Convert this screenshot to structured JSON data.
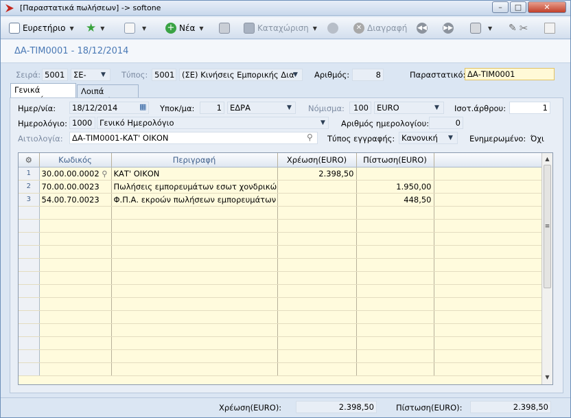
{
  "window": {
    "title": "[Παραστατικά πωλήσεων] -> softone"
  },
  "toolbar": {
    "index_label": "Ευρετήριο",
    "new_label": "Νέα",
    "save_label": "Καταχώριση",
    "delete_label": "Διαγραφή"
  },
  "document": {
    "title": "ΔΑ-ΤΙΜ0001 - 18/12/2014"
  },
  "header": {
    "series_label": "Σειρά:",
    "series_code": "5001",
    "series_name": "ΣΕ-",
    "type_label": "Τύπος:",
    "type_code": "5001",
    "type_name": "(ΣΕ) Κινήσεις Εμπορικής Δια",
    "number_label": "Αριθμός:",
    "number_value": "8",
    "doc_label": "Παραστατικό:",
    "doc_value": "ΔΑ-ΤΙΜ0001"
  },
  "tabs": [
    {
      "label": "Γενικά στοιχεία"
    },
    {
      "label": "Λοιπά στοιχεία"
    }
  ],
  "general": {
    "date_label": "Ημερ/νία:",
    "date_value": "18/12/2014",
    "branch_label": "Υποκ/μα:",
    "branch_code": "1",
    "branch_name": "ΕΔΡΑ",
    "currency_label": "Νόμισμα:",
    "currency_code": "100",
    "currency_name": "EURO",
    "rate_label": "Ισοτ.άρθρου:",
    "rate_value": "1",
    "journal_label": "Ημερολόγιο:",
    "journal_code": "1000",
    "journal_name": "Γενικό Ημερολόγιο",
    "journal_no_label": "Αριθμός ημερολογίου:",
    "journal_no_value": "0",
    "reason_label": "Αιτιολογία:",
    "reason_value": "ΔΑ-ΤΙΜ0001-ΚΑΤ' ΟΙΚΟΝ",
    "entry_type_label": "Τύπος εγγραφής:",
    "entry_type_value": "Κανονική",
    "updated_label": "Ενημερωμένο:",
    "updated_value": "Όχι"
  },
  "grid": {
    "columns": [
      "Κωδικός",
      "Περιγραφή",
      "Χρέωση(EURO)",
      "Πίστωση(EURO)"
    ],
    "rows": [
      {
        "n": "1",
        "code": "30.00.00.0002",
        "desc": "ΚΑΤ' ΟΙΚΟΝ",
        "debit": "2.398,50",
        "credit": ""
      },
      {
        "n": "2",
        "code": "70.00.00.0023",
        "desc": "Πωλήσεις εμπορευμάτων εσωτ χονδρικώς",
        "debit": "",
        "credit": "1.950,00"
      },
      {
        "n": "3",
        "code": "54.00.70.0023",
        "desc": "Φ.Π.Α. εκροών πωλήσεων εμπορευμάτων",
        "debit": "",
        "credit": "448,50"
      }
    ]
  },
  "footer": {
    "debit_label": "Χρέωση(EURO):",
    "debit_value": "2.398,50",
    "credit_label": "Πίστωση(EURO):",
    "credit_value": "2.398,50"
  },
  "colors": {
    "accent": "#4a79b5",
    "grid_bg": "#fffbdd",
    "field_highlight": "#fff9d7"
  }
}
